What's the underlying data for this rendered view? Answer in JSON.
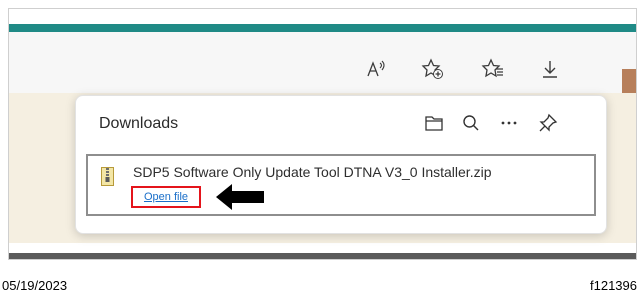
{
  "downloads": {
    "title": "Downloads",
    "item": {
      "file_name": "SDP5 Software Only Update Tool DTNA V3_0 Installer.zip",
      "open_file_label": "Open file"
    }
  },
  "caption": {
    "date": "05/19/2023",
    "figure_id": "f121396"
  },
  "icons": {
    "toolbar": [
      "read-aloud-icon",
      "add-favorite-icon",
      "favorites-icon",
      "downloads-icon"
    ],
    "flyout": [
      "open-folder-icon",
      "search-icon",
      "more-icon",
      "pin-icon"
    ],
    "file": "zip-file-icon",
    "annotation": "pointer-arrow-icon"
  },
  "colors": {
    "accent": "#1f8a86",
    "highlight": "#e4141b",
    "link": "#1a6fc9",
    "content_background": "#f5efe1"
  }
}
